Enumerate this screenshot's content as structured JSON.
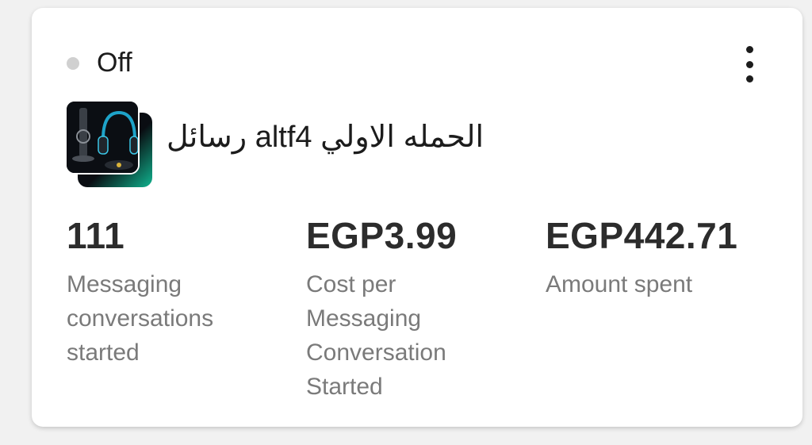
{
  "card": {
    "status": "Off",
    "campaign_name": "الحمله الاولي altf4 رسائل",
    "metrics": [
      {
        "value": "111",
        "label": "Messaging conversations started"
      },
      {
        "value": "EGP3.99",
        "label": "Cost per Messaging Conversation Started"
      },
      {
        "value": "EGP442.71",
        "label": "Amount spent"
      }
    ]
  },
  "icons": {
    "menu": "more-vertical-icon",
    "status": "status-dot-icon",
    "thumbnail": "headset-product-thumbnail"
  },
  "colors": {
    "status_dot": "#d0d0d0",
    "value_text": "#2c2c2c",
    "label_text": "#7a7a7a"
  }
}
